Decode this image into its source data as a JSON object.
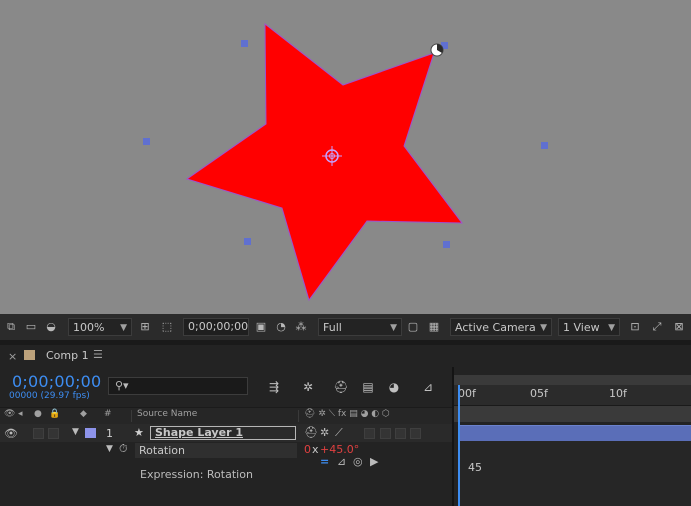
{
  "viewer": {
    "zoom": "100%",
    "timecode": "0;00;00;00",
    "resolution": "Full",
    "camera": "Active Camera",
    "views": "1 View",
    "colors": {
      "star_fill": "#ff0000",
      "background": "#898989",
      "handles": "#6070d0"
    }
  },
  "timeline": {
    "tab": {
      "label": "Comp 1"
    },
    "current_time": "0;00;00;00",
    "fps_label": "00000 (29.97 fps)",
    "column_header": {
      "number": "#",
      "source_name": "Source Name"
    },
    "layer": {
      "number": "1",
      "name": "Shape Layer 1"
    },
    "property": {
      "name": "Rotation",
      "value_turns": "0",
      "value_x": "x",
      "value_degrees": "+45.0°"
    },
    "expression": {
      "label": "Expression: Rotation"
    },
    "ruler": {
      "ticks": [
        "00f",
        "05f",
        "10f"
      ]
    },
    "graph_value": "45",
    "colors": {
      "timecode": "#3d8df2",
      "layer_bar": "#5a6eb8",
      "label_swatch": "#8d93ea"
    }
  }
}
